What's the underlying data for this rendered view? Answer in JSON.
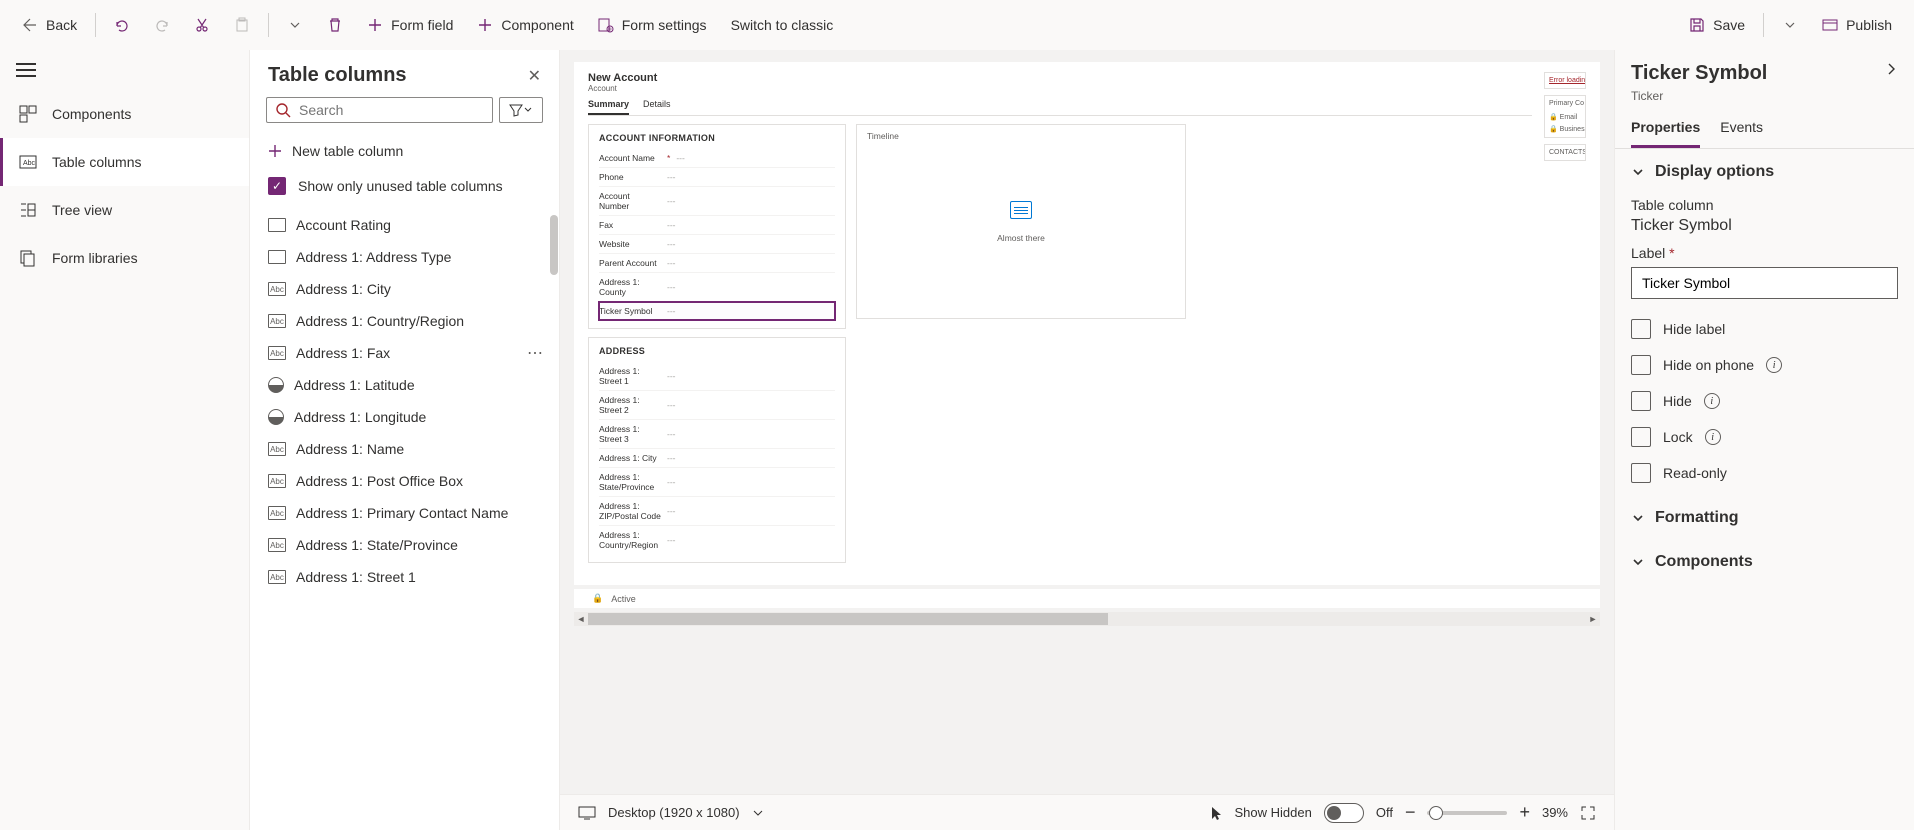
{
  "toolbar": {
    "back": "Back",
    "form_field": "Form field",
    "component": "Component",
    "form_settings": "Form settings",
    "switch_classic": "Switch to classic",
    "save": "Save",
    "publish": "Publish"
  },
  "nav": {
    "components": "Components",
    "table_columns": "Table columns",
    "tree_view": "Tree view",
    "form_libraries": "Form libraries"
  },
  "columns_panel": {
    "title": "Table columns",
    "search_placeholder": "Search",
    "new_column": "New table column",
    "show_unused": "Show only unused table columns",
    "items": [
      {
        "type": "blank",
        "label": "Account Rating"
      },
      {
        "type": "blank",
        "label": "Address 1: Address Type"
      },
      {
        "type": "abc",
        "label": "Address 1: City"
      },
      {
        "type": "abc",
        "label": "Address 1: Country/Region"
      },
      {
        "type": "abc",
        "label": "Address 1: Fax",
        "more": true
      },
      {
        "type": "circle",
        "label": "Address 1: Latitude"
      },
      {
        "type": "circle",
        "label": "Address 1: Longitude"
      },
      {
        "type": "abc",
        "label": "Address 1: Name"
      },
      {
        "type": "abc",
        "label": "Address 1: Post Office Box"
      },
      {
        "type": "abc",
        "label": "Address 1: Primary Contact Name"
      },
      {
        "type": "abc",
        "label": "Address 1: State/Province"
      },
      {
        "type": "abc",
        "label": "Address 1: Street 1"
      }
    ]
  },
  "form": {
    "title": "New Account",
    "entity": "Account",
    "tabs": [
      "Summary",
      "Details"
    ],
    "account_info": {
      "title": "ACCOUNT INFORMATION",
      "fields": [
        {
          "label": "Account Name",
          "required": true,
          "value": "---"
        },
        {
          "label": "Phone",
          "value": "---"
        },
        {
          "label": "Account Number",
          "value": "---"
        },
        {
          "label": "Fax",
          "value": "---"
        },
        {
          "label": "Website",
          "value": "---"
        },
        {
          "label": "Parent Account",
          "value": "---"
        },
        {
          "label": "Address 1: County",
          "value": "---"
        },
        {
          "label": "Ticker Symbol",
          "value": "---",
          "selected": true
        }
      ]
    },
    "address": {
      "title": "ADDRESS",
      "fields": [
        {
          "label": "Address 1: Street 1",
          "value": "---"
        },
        {
          "label": "Address 1: Street 2",
          "value": "---"
        },
        {
          "label": "Address 1: Street 3",
          "value": "---"
        },
        {
          "label": "Address 1: City",
          "value": "---"
        },
        {
          "label": "Address 1: State/Province",
          "value": "---"
        },
        {
          "label": "Address 1: ZIP/Postal Code",
          "value": "---"
        },
        {
          "label": "Address 1: Country/Region",
          "value": "---"
        }
      ]
    },
    "timeline": {
      "title": "Timeline",
      "status": "Almost there"
    },
    "side": {
      "error": "Error loading",
      "primary": "Primary Co",
      "email": "Email",
      "business": "Business",
      "contacts": "CONTACTS"
    },
    "footer_status": "Active"
  },
  "bottom": {
    "viewport": "Desktop (1920 x 1080)",
    "show_hidden": "Show Hidden",
    "toggle_state": "Off",
    "zoom": "39%"
  },
  "props": {
    "title": "Ticker Symbol",
    "subtype": "Ticker",
    "tabs": {
      "properties": "Properties",
      "events": "Events"
    },
    "display_options": "Display options",
    "table_column_label": "Table column",
    "table_column_value": "Ticker Symbol",
    "label_label": "Label",
    "label_value": "Ticker Symbol",
    "checks": {
      "hide_label": "Hide label",
      "hide_on_phone": "Hide on phone",
      "hide": "Hide",
      "lock": "Lock",
      "read_only": "Read-only"
    },
    "formatting": "Formatting",
    "components": "Components"
  }
}
